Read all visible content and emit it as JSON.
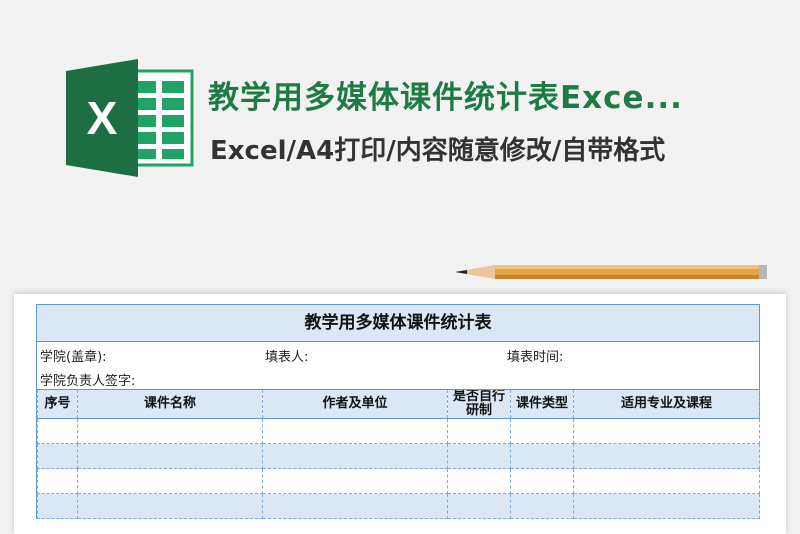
{
  "header": {
    "title": "教学用多媒体课件统计表Exce...",
    "subtitle": "Excel/A4打印/内容随意修改/自带格式",
    "logo_letter": "X"
  },
  "sheet": {
    "title": "教学用多媒体课件统计表",
    "info": {
      "college": "学院(盖章):",
      "filler": "填表人:",
      "fill_time": "填表时间:",
      "responsible": "学院负责人签字:"
    },
    "columns": [
      "序号",
      "课件名称",
      "作者及单位",
      "是否自行研制",
      "课件类型",
      "适用专业及课程"
    ]
  },
  "colors": {
    "excel_green": "#1f7a44",
    "header_fill": "#dbe7f4",
    "border_blue": "#5b9bd5"
  }
}
